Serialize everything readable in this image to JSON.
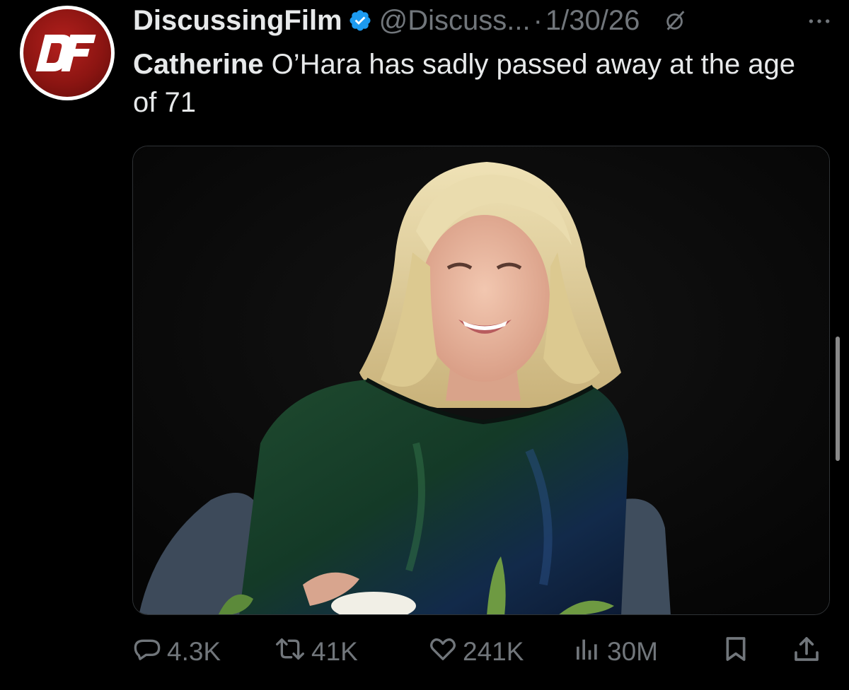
{
  "tweet": {
    "author_name": "DiscussingFilm",
    "handle": "@Discuss...",
    "separator": "·",
    "date": "1/30/26",
    "text_bold": "Catherine",
    "text_rest": " O’Hara has sadly passed away at the age of 71",
    "avatar_logo_text": "DF"
  },
  "actions": {
    "replies": "4.3K",
    "reposts": "41K",
    "likes": "241K",
    "views": "30M"
  },
  "icons": {
    "verified": "verified-badge-icon",
    "grok": "grok-icon",
    "more": "more-icon",
    "reply": "reply-icon",
    "repost": "repost-icon",
    "like": "heart-icon",
    "views": "views-icon",
    "bookmark": "bookmark-icon",
    "share": "share-icon"
  },
  "colors": {
    "background": "#000000",
    "text": "#e7e9ea",
    "muted": "#71767b",
    "verified": "#1d9bf0",
    "avatar_red": "#8c1512"
  }
}
